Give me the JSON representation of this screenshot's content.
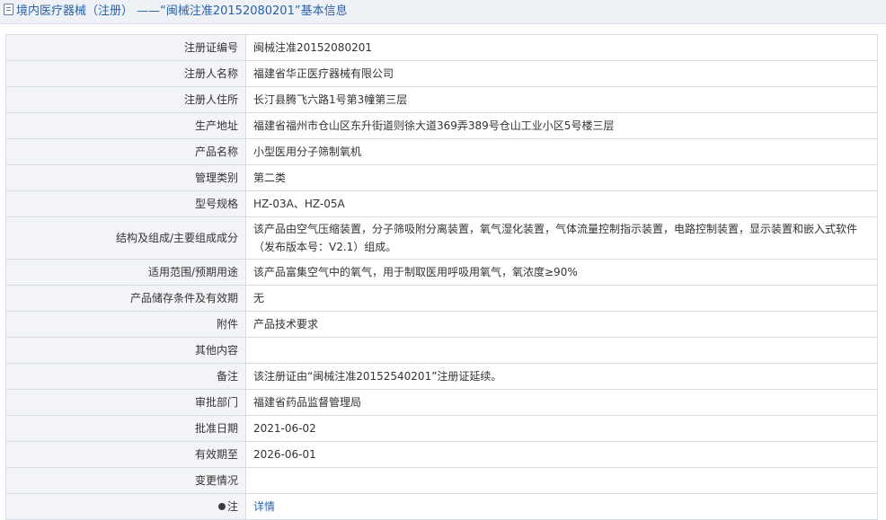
{
  "header": {
    "title": "境内医疗器械（注册） ——“闽械注准20152080201”基本信息"
  },
  "rows": [
    {
      "label": "注册证编号",
      "value": "闽械注准20152080201"
    },
    {
      "label": "注册人名称",
      "value": "福建省华正医疗器械有限公司"
    },
    {
      "label": "注册人住所",
      "value": "长汀县腾飞六路1号第3幢第三层"
    },
    {
      "label": "生产地址",
      "value": "福建省福州市仓山区东升街道则徐大道369弄389号仓山工业小区5号楼三层"
    },
    {
      "label": "产品名称",
      "value": "小型医用分子筛制氧机"
    },
    {
      "label": "管理类别",
      "value": "第二类"
    },
    {
      "label": "型号规格",
      "value": "HZ-03A、HZ-05A"
    },
    {
      "label": "结构及组成/主要组成成分",
      "value": "该产品由空气压缩装置，分子筛吸附分离装置，氧气湿化装置，气体流量控制指示装置，电路控制装置，显示装置和嵌入式软件（发布版本号：V2.1）组成。"
    },
    {
      "label": "适用范围/预期用途",
      "value": "该产品富集空气中的氧气，用于制取医用呼吸用氧气，氧浓度≥90%"
    },
    {
      "label": "产品储存条件及有效期",
      "value": "无"
    },
    {
      "label": "附件",
      "value": "产品技术要求"
    },
    {
      "label": "其他内容",
      "value": ""
    },
    {
      "label": "备注",
      "value": "该注册证由“闽械注准20152540201”注册证延续。"
    },
    {
      "label": "审批部门",
      "value": "福建省药品监督管理局"
    },
    {
      "label": "批准日期",
      "value": "2021-06-02"
    },
    {
      "label": "有效期至",
      "value": "2026-06-01"
    },
    {
      "label": "变更情况",
      "value": ""
    },
    {
      "label": "注",
      "value": "详情"
    }
  ],
  "icons": {
    "header_icon": "document-icon",
    "note_icon": "bulb-icon"
  },
  "colors": {
    "link": "#2a62a8",
    "label_bg": "#f2f4f7",
    "header_bg": "#eef1f6"
  }
}
